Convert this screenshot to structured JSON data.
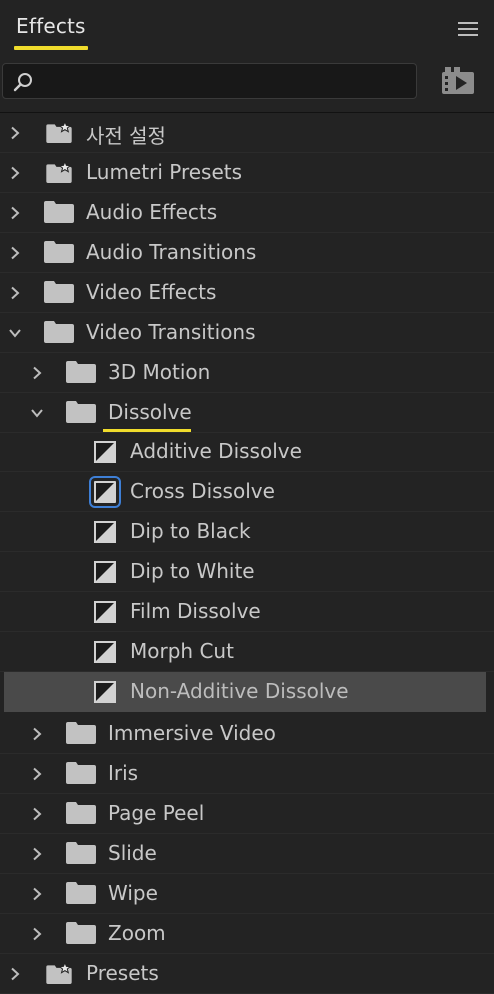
{
  "panel": {
    "title": "Effects",
    "accent_color": "#f0dc2c",
    "focus_color": "#3e7fd6"
  },
  "search": {
    "value": "",
    "placeholder": ""
  },
  "tree": [
    {
      "label": "사전 설정",
      "type": "preset-folder",
      "expanded": false
    },
    {
      "label": "Lumetri Presets",
      "type": "preset-folder",
      "expanded": false
    },
    {
      "label": "Audio Effects",
      "type": "folder",
      "expanded": false
    },
    {
      "label": "Audio Transitions",
      "type": "folder",
      "expanded": false
    },
    {
      "label": "Video Effects",
      "type": "folder",
      "expanded": false
    },
    {
      "label": "Video Transitions",
      "type": "folder",
      "expanded": true
    },
    {
      "label": "3D Motion",
      "type": "folder",
      "expanded": false
    },
    {
      "label": "Dissolve",
      "type": "folder",
      "expanded": true
    },
    {
      "label": "Additive Dissolve",
      "type": "transition"
    },
    {
      "label": "Cross Dissolve",
      "type": "transition",
      "focused": true
    },
    {
      "label": "Dip to Black",
      "type": "transition"
    },
    {
      "label": "Dip to White",
      "type": "transition"
    },
    {
      "label": "Film Dissolve",
      "type": "transition"
    },
    {
      "label": "Morph Cut",
      "type": "transition"
    },
    {
      "label": "Non-Additive Dissolve",
      "type": "transition",
      "selected": true
    },
    {
      "label": "Immersive Video",
      "type": "folder",
      "expanded": false
    },
    {
      "label": "Iris",
      "type": "folder",
      "expanded": false
    },
    {
      "label": "Page Peel",
      "type": "folder",
      "expanded": false
    },
    {
      "label": "Slide",
      "type": "folder",
      "expanded": false
    },
    {
      "label": "Wipe",
      "type": "folder",
      "expanded": false
    },
    {
      "label": "Zoom",
      "type": "folder",
      "expanded": false
    },
    {
      "label": "Presets",
      "type": "preset-folder",
      "expanded": false
    }
  ]
}
